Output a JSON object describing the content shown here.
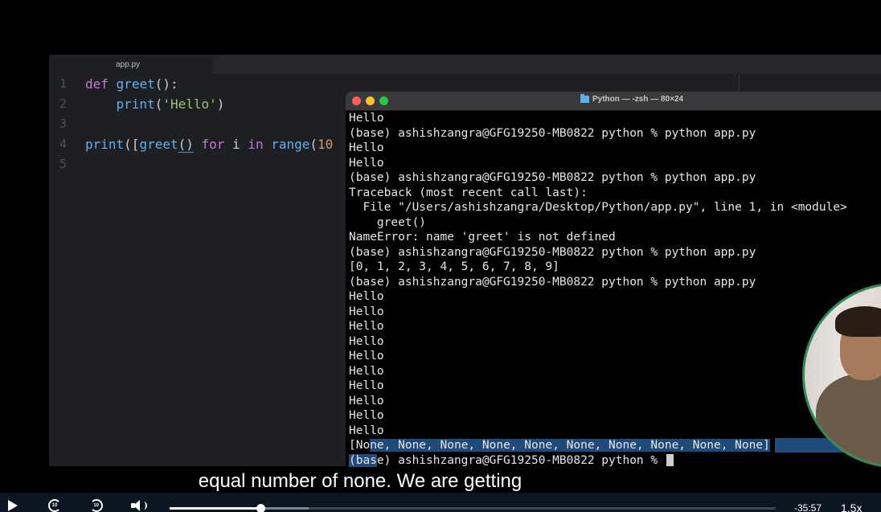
{
  "editor": {
    "tab_label": "app.py",
    "line_numbers": [
      "1",
      "2",
      "3",
      "4",
      "5"
    ],
    "code": {
      "l1_kw": "def",
      "l1_fn": "greet",
      "l1_rest": "():",
      "l2_indent": "    ",
      "l2_fn": "print",
      "l2_open": "(",
      "l2_str": "'Hello'",
      "l2_close": ")",
      "l4_fn": "print",
      "l4_open": "([",
      "l4_call": "greet",
      "l4_parens": "()",
      "l4_sp1": " ",
      "l4_for": "for",
      "l4_var": " i ",
      "l4_in": "in",
      "l4_sp2": " ",
      "l4_range": "range",
      "l4_open2": "(",
      "l4_num": "10"
    }
  },
  "terminal": {
    "title": "Python — -zsh — 80×24",
    "lines": [
      "Hello",
      "(base) ashishzangra@GFG19250-MB0822 python % python app.py",
      "Hello",
      "Hello",
      "(base) ashishzangra@GFG19250-MB0822 python % python app.py",
      "Traceback (most recent call last):",
      "  File \"/Users/ashishzangra/Desktop/Python/app.py\", line 1, in <module>",
      "    greet()",
      "NameError: name 'greet' is not defined",
      "(base) ashishzangra@GFG19250-MB0822 python % python app.py",
      "[0, 1, 2, 3, 4, 5, 6, 7, 8, 9]",
      "(base) ashishzangra@GFG19250-MB0822 python % python app.py",
      "Hello",
      "Hello",
      "Hello",
      "Hello",
      "Hello",
      "Hello",
      "Hello",
      "Hello",
      "Hello",
      "Hello"
    ],
    "result_prefix": "[No",
    "result_rest": "ne, None, None, None, None, None, None, None, None, None]",
    "prompt_sel": "(bas",
    "prompt_rest": "e) ashishzangra@GFG19250-MB0822 python % "
  },
  "caption": "equal number of none. We are getting",
  "player": {
    "rewind_label": "10",
    "forward_label": "10",
    "time_remaining": "-35:57",
    "speed": "1.5x",
    "progress_fraction": 0.15,
    "buffered_fraction": 0.23
  }
}
